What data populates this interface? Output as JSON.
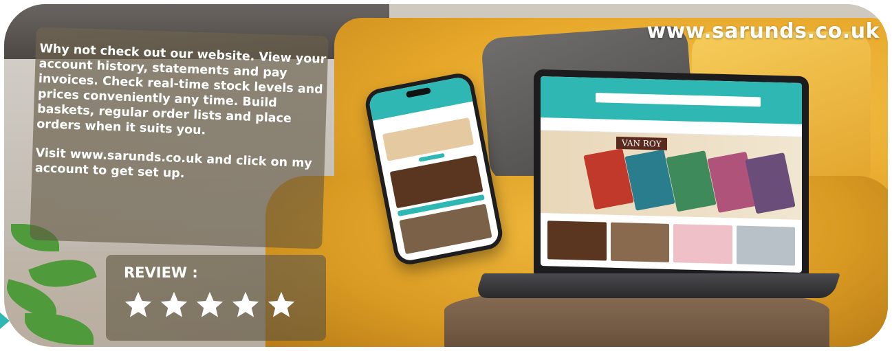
{
  "banner": {
    "url_text": "www.sarunds.co.uk",
    "paragraph_1": "Why not check out our website. View your account history, statements and pay invoices. Check real-time stock levels and prices conveniently any time. Build baskets, regular order lists and place orders when it suits you.",
    "paragraph_2": "Visit www.sarunds.co.uk and click on my account to get set up."
  },
  "review": {
    "label": "REVIEW :",
    "rating": 5,
    "max_rating": 5,
    "star_color": "#ffffff"
  },
  "devices": {
    "laptop_brand": "VAN ROY",
    "accent_color": "#2fb7b3"
  },
  "icons": [
    "star-icon"
  ]
}
